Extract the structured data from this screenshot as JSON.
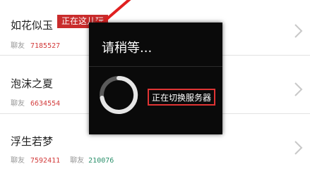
{
  "list": {
    "rows": [
      {
        "name": "如花似玉",
        "tag": "正在这儿玩",
        "friend_label": "聊友",
        "friend_id": "7185527"
      },
      {
        "name": "泡沫之夏",
        "friend_label": "聊友",
        "friend_id": "6634554"
      },
      {
        "name": "浮生若梦",
        "friend_label": "聊友",
        "friend_id": "7592411",
        "second_label": "聊友",
        "second_id": "210076"
      }
    ]
  },
  "dialog": {
    "title": "请稍等...",
    "message": "正在切换服务器"
  },
  "icons": {
    "chevron": "chevron-right-icon",
    "spinner": "loading-spinner-icon",
    "annotation": "red-arrow-annotation"
  },
  "colors": {
    "accent_red": "#c92c2c",
    "id_red": "#d23a3a",
    "id_green": "#2a8f6a",
    "dialog_bg": "#0a0a0a",
    "highlight_border": "#e03434"
  }
}
